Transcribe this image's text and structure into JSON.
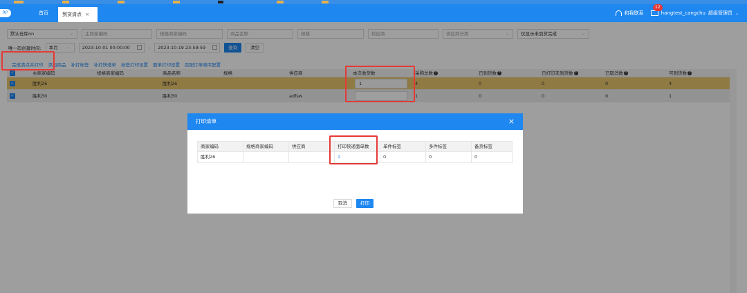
{
  "header": {
    "logo": "RP",
    "home_tab": "首页",
    "active_tab": "到货清点",
    "active_tab_close": "×",
    "contact": "和我联系",
    "notification_count": "12",
    "username": "hangtest_cangchu",
    "role": "超级管理员",
    "role_caret": "⌄"
  },
  "filters": {
    "warehouse": "默认仓库on",
    "main_code": "主商家编码",
    "spec_code": "规格商家编码",
    "product_name": "商品名称",
    "spec": "规格",
    "supplier": "供应商",
    "supplier_category": "供应商分类",
    "show_only": "仅显示未到货完成",
    "created_label": "唯一码创建时间:",
    "period": "本月",
    "date_from": "2023-10-01 00:00:00",
    "date_sep": "-",
    "date_to": "2023-10-19 23:59:59",
    "query_btn": "查询",
    "clear_btn": "清空"
  },
  "actions": [
    "完成清点并打印",
    "添加商品",
    "补打标签",
    "补打快递单",
    "标签打印设置",
    "面单打印设置",
    "匹配订单顺序配置"
  ],
  "grid": {
    "columns": [
      "主商家编码",
      "规格商家编码",
      "商品名称",
      "规格",
      "供应商",
      "本次收货数",
      "采购总数",
      "已到货数",
      "已打印未到货数",
      "已取消数",
      "可到货数"
    ],
    "rows": [
      {
        "main_code": "胜利26",
        "spec_code": "",
        "name": "胜利26",
        "spec": "",
        "supplier": "",
        "receive": "1",
        "total": "4",
        "arrived": "0",
        "printed": "0",
        "cancelled": "0",
        "available": "4"
      },
      {
        "main_code": "胜利30",
        "spec_code": "",
        "name": "胜利30",
        "spec": "",
        "supplier": "adfsw",
        "receive": "",
        "total": "1",
        "arrived": "0",
        "printed": "0",
        "cancelled": "0",
        "available": "1"
      }
    ]
  },
  "modal": {
    "title": "打印清单",
    "close": "×",
    "columns": [
      "商家编码",
      "规格商家编码",
      "供应商",
      "打印快递面单数",
      "单件标签",
      "多件标签",
      "备货标签"
    ],
    "row": [
      "胜利26",
      "",
      "",
      "1",
      "0",
      "0",
      "0"
    ],
    "cancel_btn": "取消",
    "print_btn": "打印"
  },
  "colors": {
    "primary": "#1e87f0",
    "highlight_row": "#e8c66e",
    "annotation": "#e53935"
  }
}
